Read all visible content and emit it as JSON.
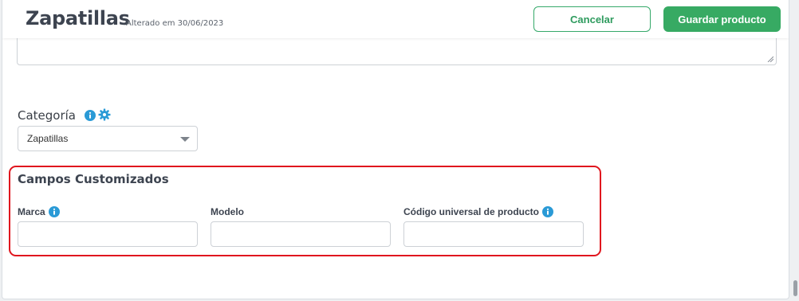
{
  "header": {
    "title": "Zapatillas",
    "subtitle": "Alterado em 30/06/2023",
    "cancel_label": "Cancelar",
    "save_label": "Guardar producto"
  },
  "description": {
    "value": ""
  },
  "category": {
    "label": "Categoría",
    "selected": "Zapatillas"
  },
  "custom_fields": {
    "title": "Campos Customizados",
    "fields": [
      {
        "label": "Marca",
        "value": "",
        "has_info": true
      },
      {
        "label": "Modelo",
        "value": "",
        "has_info": false
      },
      {
        "label": "Código universal de producto",
        "value": "",
        "has_info": true
      }
    ]
  },
  "colors": {
    "accent_green": "#37aa63",
    "info_blue": "#2a9ad6",
    "highlight_red": "#e0161e"
  }
}
